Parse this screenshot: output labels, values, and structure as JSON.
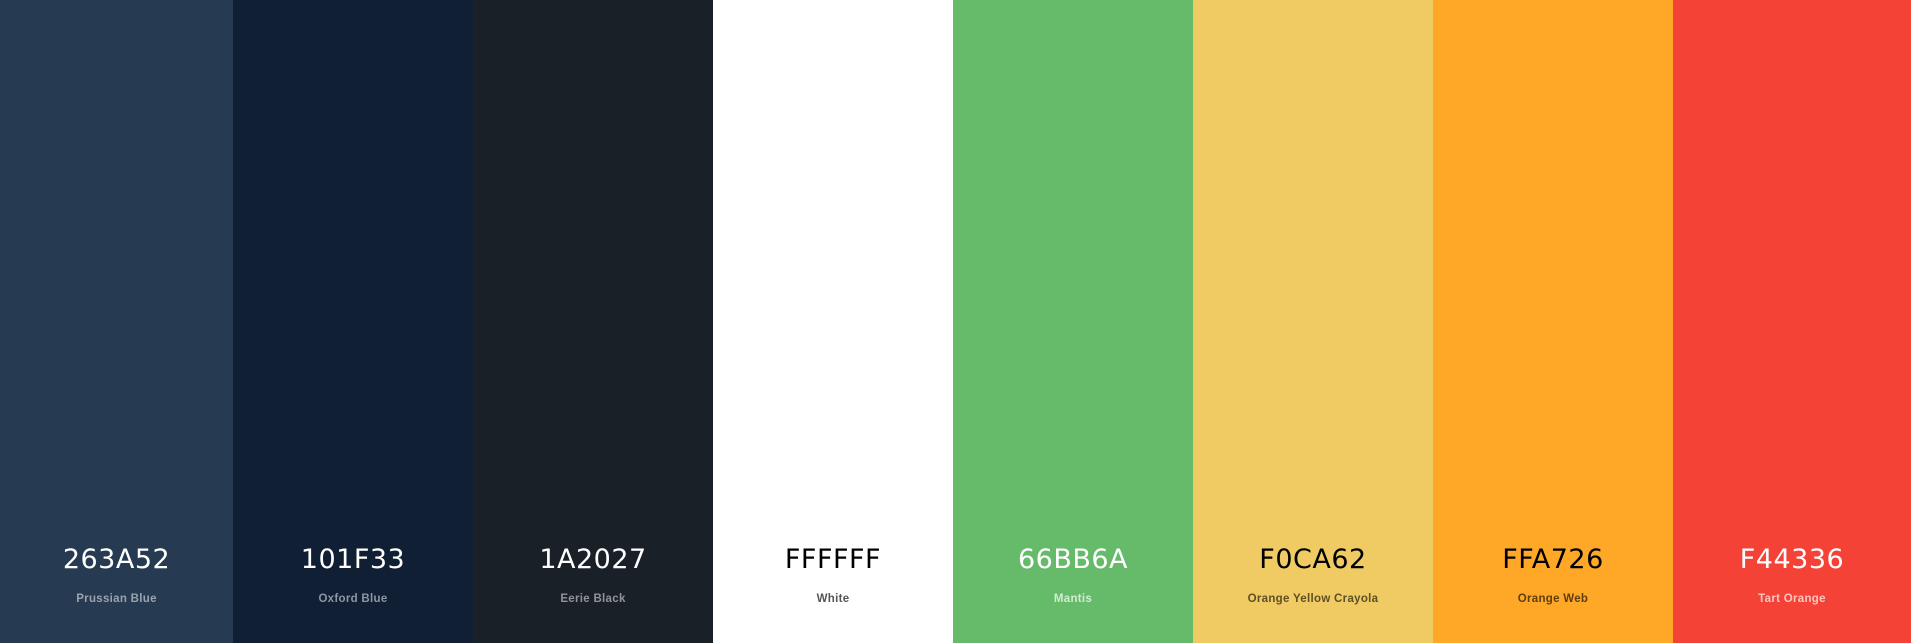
{
  "palette": [
    {
      "hex": "263A52",
      "name": "Prussian Blue",
      "color": "#263A52",
      "hex_color": "#ffffff",
      "name_color": "#9aa3ae"
    },
    {
      "hex": "101F33",
      "name": "Oxford Blue",
      "color": "#101F33",
      "hex_color": "#ffffff",
      "name_color": "#8d96a3"
    },
    {
      "hex": "1A2027",
      "name": "Eerie Black",
      "color": "#1A2027",
      "hex_color": "#ffffff",
      "name_color": "#8f949a"
    },
    {
      "hex": "FFFFFF",
      "name": "White",
      "color": "#FFFFFF",
      "hex_color": "#000000",
      "name_color": "#555555"
    },
    {
      "hex": "66BB6A",
      "name": "Mantis",
      "color": "#66BB6A",
      "hex_color": "#ffffff",
      "name_color": "#d2ecd3"
    },
    {
      "hex": "F0CA62",
      "name": "Orange Yellow Crayola",
      "color": "#F0CA62",
      "hex_color": "#000000",
      "name_color": "#5e4f26"
    },
    {
      "hex": "FFA726",
      "name": "Orange Web",
      "color": "#FFA726",
      "hex_color": "#000000",
      "name_color": "#5e3e10"
    },
    {
      "hex": "F44336",
      "name": "Tart Orange",
      "color": "#F44336",
      "hex_color": "#ffffff",
      "name_color": "#fcc5c0"
    }
  ]
}
